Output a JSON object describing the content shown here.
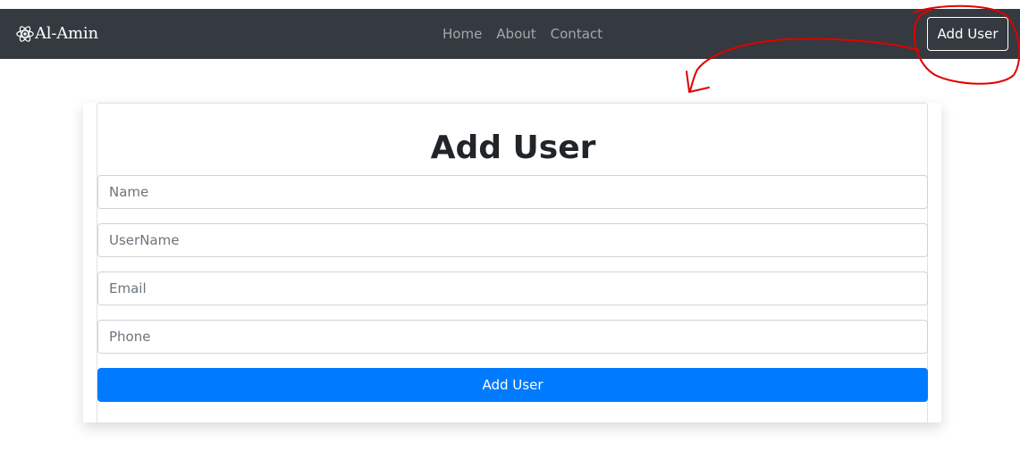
{
  "navbar": {
    "brand": "Al-Amin",
    "brand_icon": "react-atom-icon",
    "links": [
      "Home",
      "About",
      "Contact"
    ],
    "add_user_button": "Add User"
  },
  "form": {
    "title": "Add User",
    "fields": [
      {
        "placeholder": "Name"
      },
      {
        "placeholder": "UserName"
      },
      {
        "placeholder": "Email"
      },
      {
        "placeholder": "Phone"
      }
    ],
    "submit_label": "Add User"
  },
  "colors": {
    "navbar_bg": "#343a40",
    "primary": "#007bff",
    "annotation": "#e00000"
  }
}
